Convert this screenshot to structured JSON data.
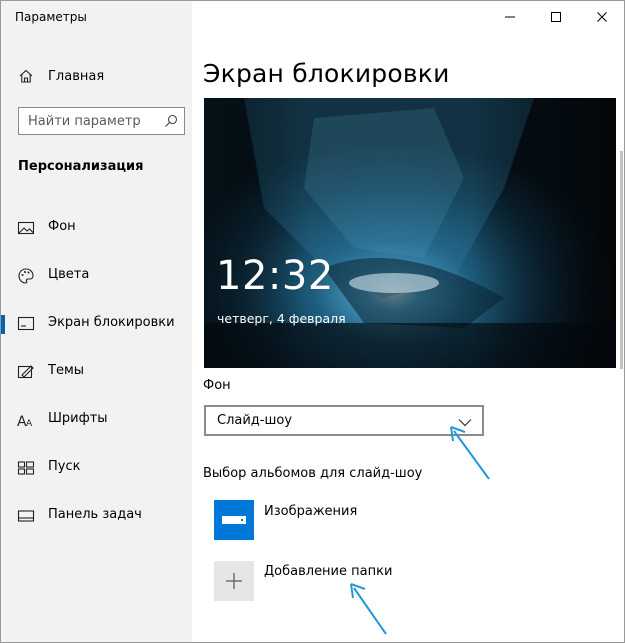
{
  "window": {
    "title": "Параметры"
  },
  "titlebar": {
    "minimize": "minimize-icon",
    "maximize": "maximize-icon",
    "close": "close-icon"
  },
  "sidebar": {
    "home_label": "Главная",
    "search": {
      "placeholder": "Найти параметр",
      "value": ""
    },
    "section_title": "Персонализация",
    "items": [
      {
        "label": "Фон",
        "icon": "image-icon",
        "selected": false
      },
      {
        "label": "Цвета",
        "icon": "palette-icon",
        "selected": false
      },
      {
        "label": "Экран блокировки",
        "icon": "lock-screen-icon",
        "selected": true
      },
      {
        "label": "Темы",
        "icon": "themes-icon",
        "selected": false
      },
      {
        "label": "Шрифты",
        "icon": "fonts-icon",
        "selected": false
      },
      {
        "label": "Пуск",
        "icon": "start-icon",
        "selected": false
      },
      {
        "label": "Панель задач",
        "icon": "taskbar-icon",
        "selected": false
      }
    ]
  },
  "main": {
    "title": "Экран блокировки",
    "preview": {
      "time": "12:32",
      "date": "четверг, 4 февраля"
    },
    "background_label": "Фон",
    "background_dropdown": {
      "selected": "Слайд-шоу"
    },
    "albums_label": "Выбор альбомов для слайд-шоу",
    "albums": [
      {
        "name": "Изображения",
        "icon": "pictures-folder-icon"
      }
    ],
    "add_folder_label": "Добавление папки"
  },
  "colors": {
    "accent": "#0078d7",
    "sidebar_bg": "#f2f2f2",
    "selection_bar": "#0063b1",
    "annotation_arrow": "#1e9ad6"
  }
}
